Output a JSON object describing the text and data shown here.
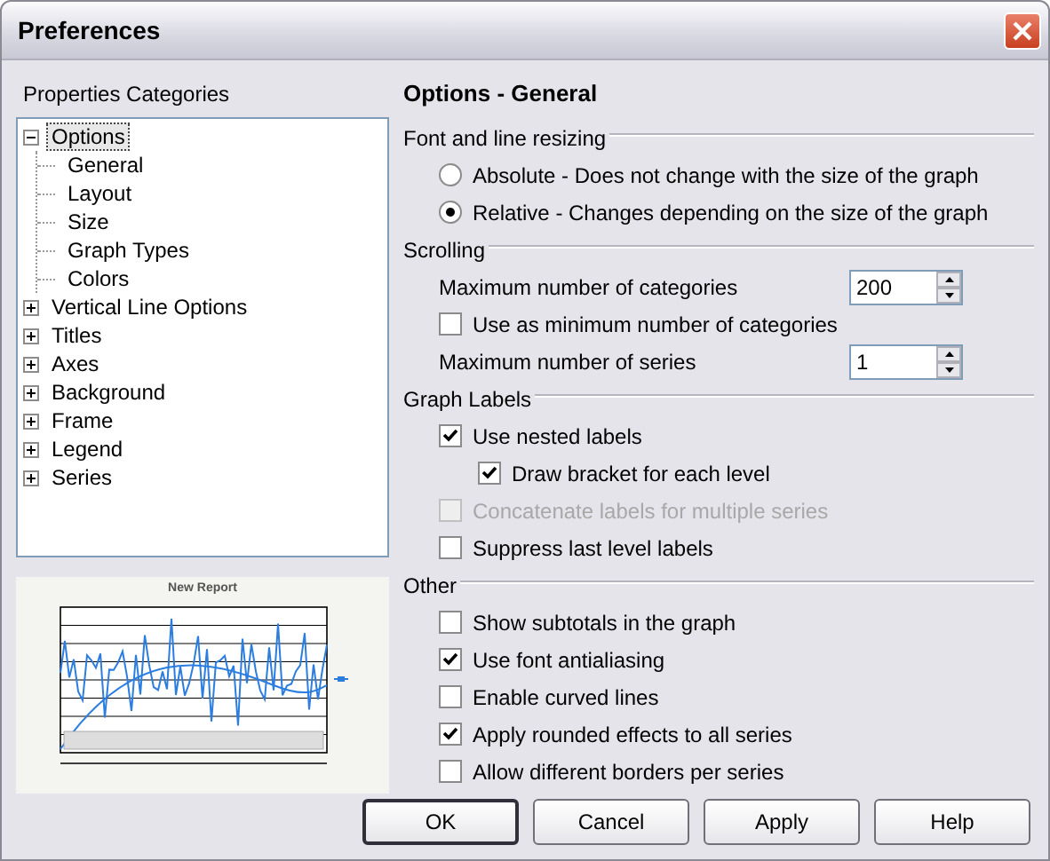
{
  "window": {
    "title": "Preferences"
  },
  "categories": {
    "label": "Properties Categories",
    "tree": [
      {
        "label": "Options",
        "expanded": true,
        "selected": true,
        "children": [
          {
            "label": "General",
            "selected": false
          },
          {
            "label": "Layout",
            "selected": false
          },
          {
            "label": "Size",
            "selected": false
          },
          {
            "label": "Graph Types",
            "selected": false
          },
          {
            "label": "Colors",
            "selected": false
          }
        ]
      },
      {
        "label": "Vertical Line Options",
        "expanded": false,
        "selected": false
      },
      {
        "label": "Titles",
        "expanded": false,
        "selected": false
      },
      {
        "label": "Axes",
        "expanded": false,
        "selected": false
      },
      {
        "label": "Background",
        "expanded": false,
        "selected": false
      },
      {
        "label": "Frame",
        "expanded": false,
        "selected": false
      },
      {
        "label": "Legend",
        "expanded": false,
        "selected": false
      },
      {
        "label": "Series",
        "expanded": false,
        "selected": false
      }
    ]
  },
  "preview": {
    "title": "New Report"
  },
  "options": {
    "heading": "Options - General",
    "sections": [
      {
        "title": "Font and line resizing",
        "items": [
          {
            "kind": "radio",
            "label": "Absolute - Does not change with the size of the graph",
            "selected": false
          },
          {
            "kind": "radio",
            "label": "Relative - Changes depending on the size of the graph",
            "selected": true
          }
        ]
      },
      {
        "title": "Scrolling",
        "items": [
          {
            "kind": "spin",
            "label": "Maximum number of categories",
            "value": "200"
          },
          {
            "kind": "checkbox",
            "label": "Use as minimum number of categories",
            "checked": false,
            "disabled": false
          },
          {
            "kind": "spin",
            "label": "Maximum number of series",
            "value": "1"
          }
        ]
      },
      {
        "title": "Graph Labels",
        "items": [
          {
            "kind": "checkbox",
            "label": "Use nested labels",
            "checked": true,
            "disabled": false,
            "children": [
              {
                "kind": "checkbox",
                "label": "Draw bracket for each level",
                "checked": true,
                "disabled": false
              }
            ]
          },
          {
            "kind": "checkbox",
            "label": "Concatenate labels for multiple series",
            "checked": false,
            "disabled": true
          },
          {
            "kind": "checkbox",
            "label": "Suppress last level labels",
            "checked": false,
            "disabled": false
          }
        ]
      },
      {
        "title": "Other",
        "items": [
          {
            "kind": "checkbox",
            "label": "Show subtotals in the graph",
            "checked": false,
            "disabled": false
          },
          {
            "kind": "checkbox",
            "label": "Use font antialiasing",
            "checked": true,
            "disabled": false
          },
          {
            "kind": "checkbox",
            "label": "Enable curved lines",
            "checked": false,
            "disabled": false
          },
          {
            "kind": "checkbox",
            "label": "Apply rounded effects to all series",
            "checked": true,
            "disabled": false
          },
          {
            "kind": "checkbox",
            "label": "Allow different borders per series",
            "checked": false,
            "disabled": false
          }
        ]
      }
    ]
  },
  "buttons": [
    {
      "label": "OK",
      "default": true
    },
    {
      "label": "Cancel",
      "default": false
    },
    {
      "label": "Apply",
      "default": false
    },
    {
      "label": "Help",
      "default": false
    }
  ]
}
